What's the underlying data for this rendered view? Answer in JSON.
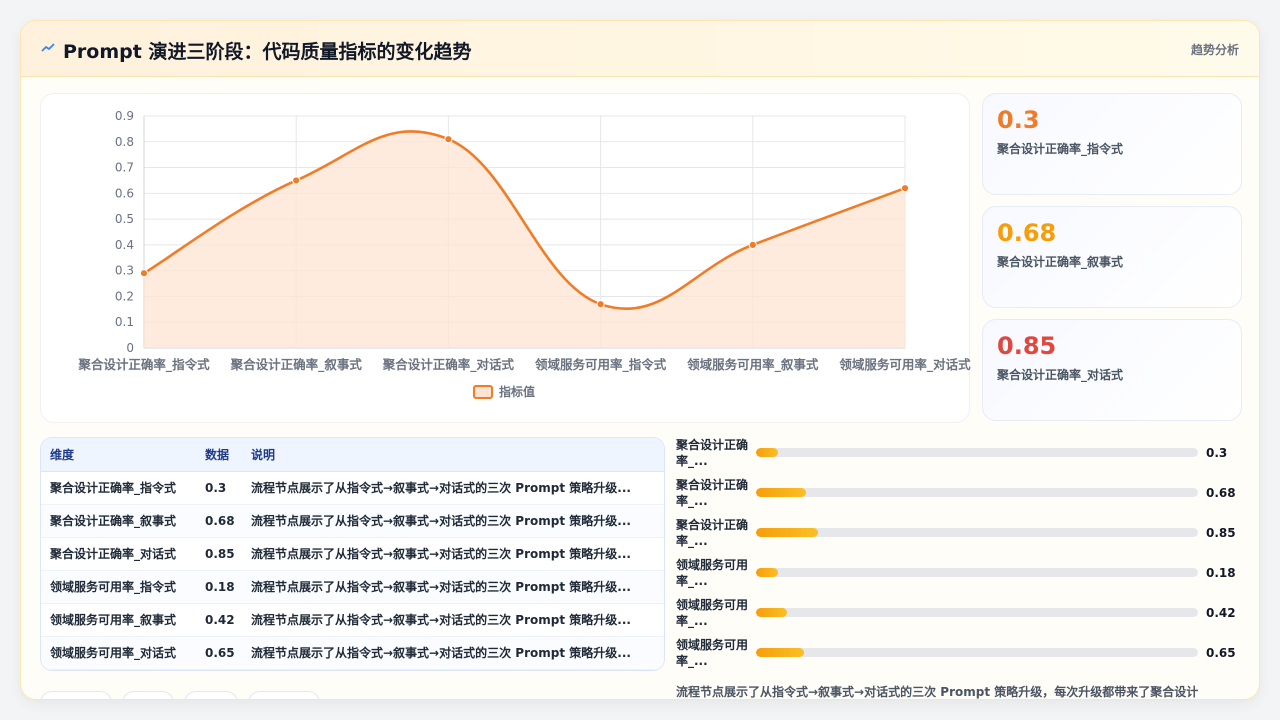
{
  "header": {
    "icon": "trend-line-icon",
    "title": "Prompt 演进三阶段：代码质量指标的变化趋势",
    "tag": "趋势分析"
  },
  "colors": {
    "line": "#f07c27",
    "area": "#fde4d2",
    "kpi1": "#f07c27",
    "kpi2": "#f59e0b",
    "kpi3": "#e0473f"
  },
  "chart_data": {
    "type": "line",
    "categories": [
      "聚合设计正确率_指令式",
      "聚合设计正确率_叙事式",
      "聚合设计正确率_对话式",
      "领域服务可用率_指令式",
      "领域服务可用率_叙事式",
      "领域服务可用率_对话式"
    ],
    "series": [
      {
        "name": "指标值",
        "values": [
          0.29,
          0.65,
          0.81,
          0.17,
          0.4,
          0.62
        ]
      }
    ],
    "ylim": [
      0,
      0.9
    ],
    "yticks": [
      "0.9",
      "0.8",
      "0.7",
      "0.6",
      "0.5",
      "0.4",
      "0.3",
      "0.2",
      "0.1",
      "0"
    ],
    "grid": true,
    "legend": "bottom",
    "fill": "area",
    "smooth": true
  },
  "kpis": [
    {
      "value": "0.3",
      "label": "聚合设计正确率_指令式"
    },
    {
      "value": "0.68",
      "label": "聚合设计正确率_叙事式"
    },
    {
      "value": "0.85",
      "label": "聚合设计正确率_对话式"
    }
  ],
  "table": {
    "headers": [
      "维度",
      "数据",
      "说明"
    ],
    "rows": [
      [
        "聚合设计正确率_指令式",
        "0.3",
        "流程节点展示了从指令式→叙事式→对话式的三次 Prompt 策略升级..."
      ],
      [
        "聚合设计正确率_叙事式",
        "0.68",
        "流程节点展示了从指令式→叙事式→对话式的三次 Prompt 策略升级..."
      ],
      [
        "聚合设计正确率_对话式",
        "0.85",
        "流程节点展示了从指令式→叙事式→对话式的三次 Prompt 策略升级..."
      ],
      [
        "领域服务可用率_指令式",
        "0.18",
        "流程节点展示了从指令式→叙事式→对话式的三次 Prompt 策略升级..."
      ],
      [
        "领域服务可用率_叙事式",
        "0.42",
        "流程节点展示了从指令式→叙事式→对话式的三次 Prompt 策略升级..."
      ],
      [
        "领域服务可用率_对话式",
        "0.65",
        "流程节点展示了从指令式→叙事式→对话式的三次 Prompt 策略升级..."
      ]
    ]
  },
  "bars": [
    {
      "label": "聚合设计正确率_...",
      "value": "0.3"
    },
    {
      "label": "聚合设计正确率_...",
      "value": "0.68"
    },
    {
      "label": "聚合设计正确率_...",
      "value": "0.85"
    },
    {
      "label": "领域服务可用率_...",
      "value": "0.18"
    },
    {
      "label": "领域服务可用率_...",
      "value": "0.42"
    },
    {
      "label": "领域服务可用率_...",
      "value": "0.65"
    }
  ],
  "note": "流程节点展示了从指令式→叙事式→对话式的三次 Prompt 策略升级，每次升级都带来了聚合设计"
}
